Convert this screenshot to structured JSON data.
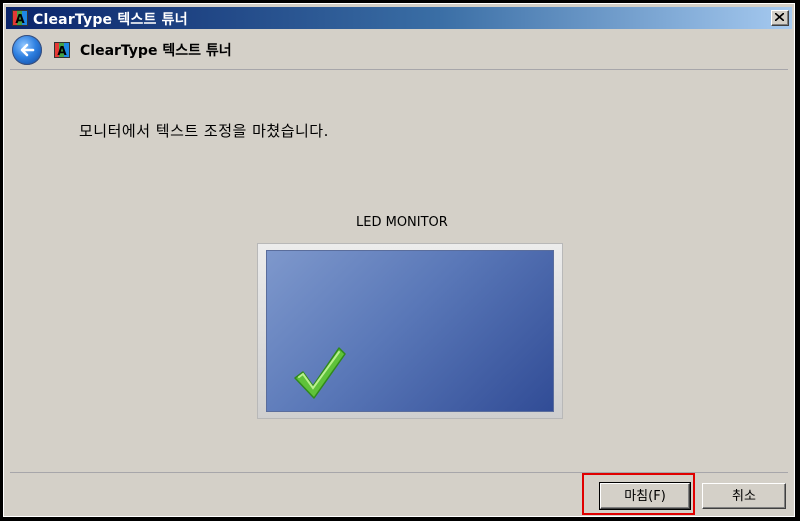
{
  "window": {
    "title": "ClearType 텍스트 튜너",
    "icon": "cleartype-icon"
  },
  "header": {
    "title": "ClearType 텍스트 튜너",
    "back_icon": "back-arrow-icon"
  },
  "content": {
    "message": "모니터에서 텍스트 조정을 마쳤습니다.",
    "monitor_label": "LED MONITOR",
    "check_icon": "green-checkmark-icon"
  },
  "buttons": {
    "finish_label": "마침(F)",
    "cancel_label": "취소"
  },
  "colors": {
    "title_bar_start": "#0a246a",
    "title_bar_end": "#a6caf0",
    "dialog_bg": "#d4d0c8",
    "highlight": "#e00000",
    "check_green": "#5fc23a"
  }
}
